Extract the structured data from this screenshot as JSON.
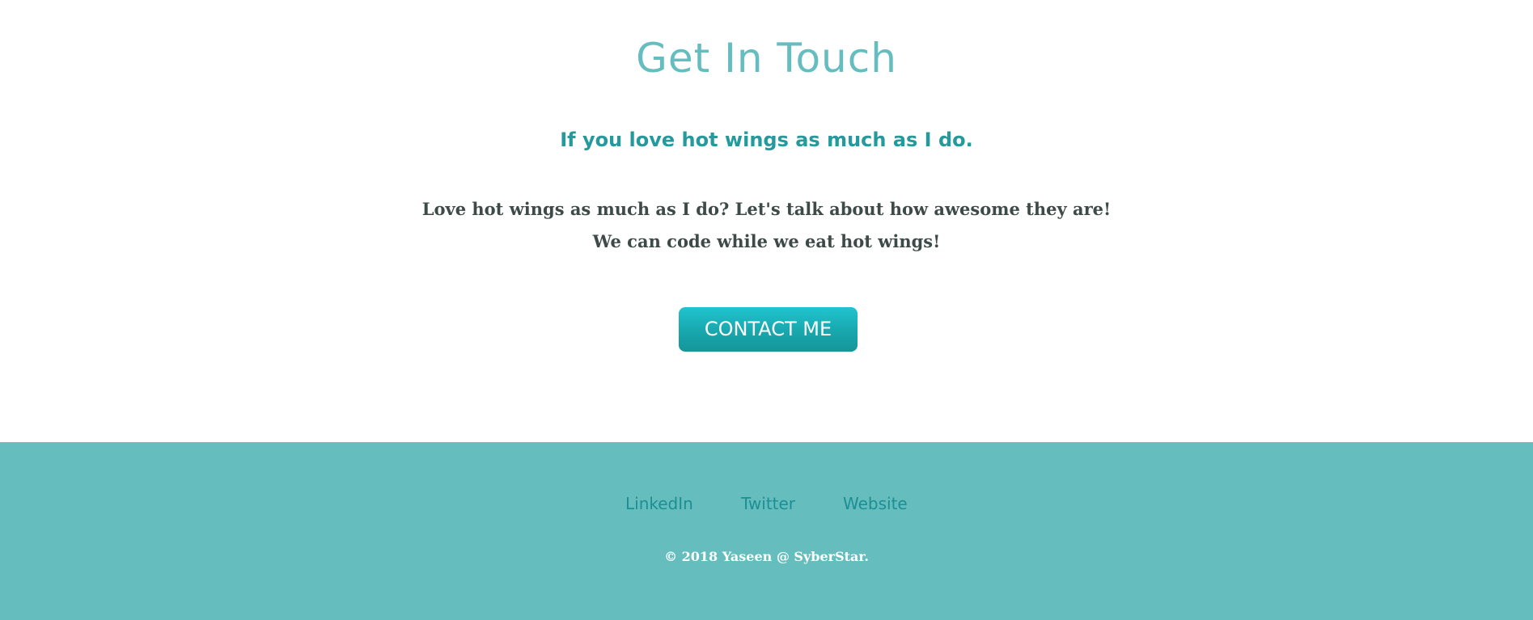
{
  "contact": {
    "title": "Get In Touch",
    "subtitle": "If you love hot wings as much as I do.",
    "text_line_1": "Love hot wings as much as I do? Let's talk about how awesome they are!",
    "text_line_2": "We can code while we eat hot wings!",
    "button_label": "CONTACT ME"
  },
  "footer": {
    "links": [
      {
        "label": "LinkedIn"
      },
      {
        "label": "Twitter"
      },
      {
        "label": "Website"
      }
    ],
    "copyright": "© 2018 Yaseen @ SyberStar."
  },
  "colors": {
    "accent": "#66bdbf",
    "subtitle": "#25999c",
    "body_text": "#3d4a48",
    "button_start": "#20c4cf",
    "button_end": "#14969a",
    "footer_bg": "#66bdbe",
    "footer_link": "#1d8f92"
  }
}
